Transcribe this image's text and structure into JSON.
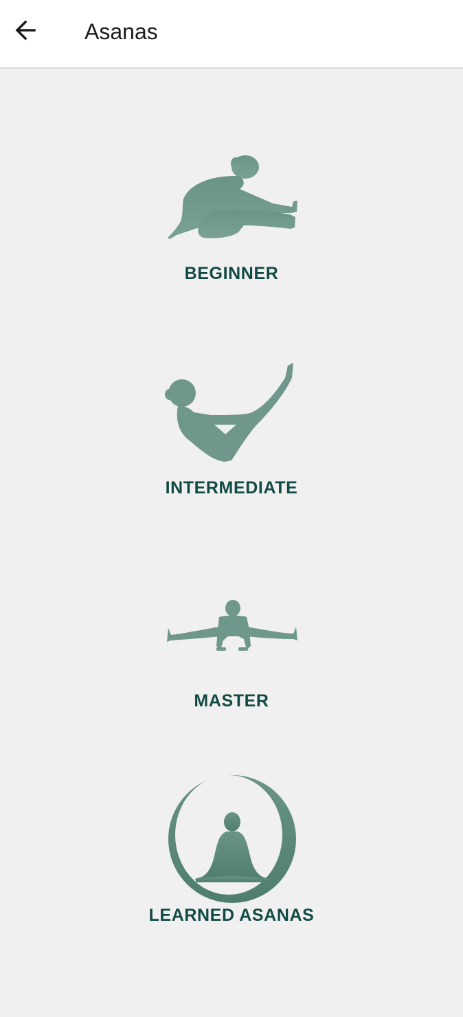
{
  "header": {
    "title": "Asanas",
    "back_icon": "arrow-left-icon"
  },
  "colors": {
    "icon": "#6f978c",
    "label": "#124a45",
    "background": "#f0f0f0"
  },
  "levels": [
    {
      "label": "BEGINNER",
      "icon": "seated-forward-bend-icon"
    },
    {
      "label": "INTERMEDIATE",
      "icon": "boat-pose-icon"
    },
    {
      "label": "MASTER",
      "icon": "arm-balance-split-icon"
    },
    {
      "label": "LEARNED ASANAS",
      "icon": "meditation-circle-icon"
    }
  ]
}
